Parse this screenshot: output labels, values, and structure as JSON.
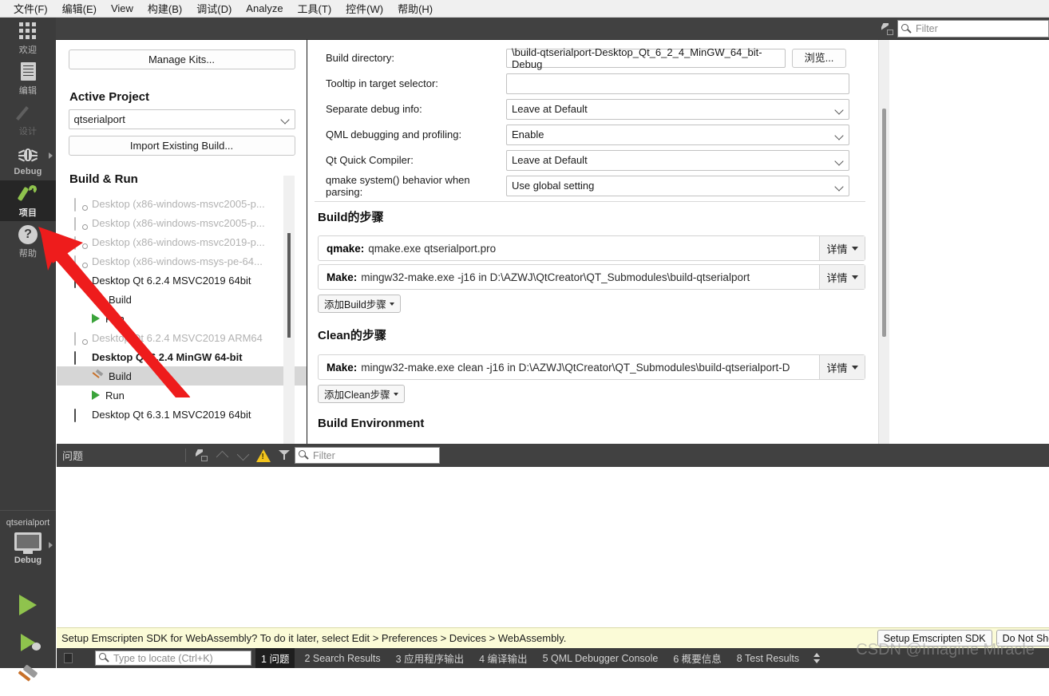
{
  "menubar": {
    "items": [
      "文件(F)",
      "编辑(E)",
      "View",
      "构建(B)",
      "调试(D)",
      "Analyze",
      "工具(T)",
      "控件(W)",
      "帮助(H)"
    ]
  },
  "modebar": {
    "items": [
      {
        "label": "欢迎",
        "icon": "grid-icon"
      },
      {
        "label": "编辑",
        "icon": "document-icon"
      },
      {
        "label": "设计",
        "icon": "pencil-icon"
      },
      {
        "label": "Debug",
        "icon": "bug-icon"
      },
      {
        "label": "项目",
        "icon": "wrench-icon"
      },
      {
        "label": "帮助",
        "icon": "question-icon"
      }
    ],
    "kit_selector": {
      "project": "qtserialport",
      "config": "Debug"
    },
    "active_index": 4,
    "accent_color": "#8fc34d"
  },
  "top_toolbar": {
    "filter_placeholder": "Filter"
  },
  "left_panel": {
    "manage_kits_label": "Manage Kits...",
    "active_project_title": "Active Project",
    "active_project_value": "qtserialport",
    "import_existing_label": "Import Existing Build...",
    "build_run_title": "Build & Run",
    "tree": [
      {
        "label": "Desktop (x86-windows-msvc2005-p...",
        "type": "kit",
        "dim": true
      },
      {
        "label": "Desktop (x86-windows-msvc2005-p...",
        "type": "kit",
        "dim": true
      },
      {
        "label": "Desktop (x86-windows-msvc2019-p...",
        "type": "kit",
        "dim": true
      },
      {
        "label": "Desktop (x86-windows-msys-pe-64...",
        "type": "kit",
        "dim": true
      },
      {
        "label": "Desktop Qt 6.2.4 MSVC2019 64bit",
        "type": "kit",
        "dim": false
      },
      {
        "label": "Build",
        "type": "build",
        "dim": false
      },
      {
        "label": "Run",
        "type": "run",
        "dim": false
      },
      {
        "label": "Desktop Qt 6.2.4 MSVC2019 ARM64",
        "type": "kit",
        "dim": true
      },
      {
        "label": "Desktop Qt 6.2.4 MinGW 64-bit",
        "type": "kit",
        "dim": false,
        "bold": true
      },
      {
        "label": "Build",
        "type": "build",
        "dim": false,
        "selected": true
      },
      {
        "label": "Run",
        "type": "run",
        "dim": false
      },
      {
        "label": "Desktop Qt 6.3.1 MSVC2019 64bit",
        "type": "kit",
        "dim": false
      }
    ]
  },
  "main_panel": {
    "fields": [
      {
        "label": "Build directory:",
        "value": "\\build-qtserialport-Desktop_Qt_6_2_4_MinGW_64_bit-Debug",
        "kind": "path",
        "button": "浏览..."
      },
      {
        "label": "Tooltip in target selector:",
        "value": "",
        "kind": "text"
      },
      {
        "label": "Separate debug info:",
        "value": "Leave at Default",
        "kind": "combo"
      },
      {
        "label": "QML debugging and profiling:",
        "value": "Enable",
        "kind": "combo"
      },
      {
        "label": "Qt Quick Compiler:",
        "value": "Leave at Default",
        "kind": "combo"
      },
      {
        "label": "qmake system() behavior when parsing:",
        "value": "Use global setting",
        "kind": "combo"
      }
    ],
    "build_steps_title": "Build的步骤",
    "build_steps": [
      {
        "name": "qmake:",
        "command": "qmake.exe qtserialport.pro",
        "details": "详情"
      },
      {
        "name": "Make:",
        "command": "mingw32-make.exe  -j16 in D:\\AZWJ\\QtCreator\\QT_Submodules\\build-qtserialport",
        "details": "详情"
      }
    ],
    "add_build_step_label": "添加Build步骤",
    "clean_steps_title": "Clean的步骤",
    "clean_steps": [
      {
        "name": "Make:",
        "command": "mingw32-make.exe clean -j16 in D:\\AZWJ\\QtCreator\\QT_Submodules\\build-qtserialport-D",
        "details": "详情"
      }
    ],
    "add_clean_step_label": "添加Clean步骤",
    "build_environment_title": "Build Environment"
  },
  "issues_pane": {
    "title": "问题",
    "filter_placeholder": "Filter"
  },
  "banner": {
    "message": "Setup Emscripten SDK for WebAssembly? To do it later, select Edit > Preferences > Devices > WebAssembly.",
    "buttons": [
      "Setup Emscripten SDK",
      "Do Not Show Again"
    ],
    "background": "#fbfbd7"
  },
  "statusbar": {
    "locator_placeholder": "Type to locate (Ctrl+K)",
    "tabs": [
      {
        "num": "1",
        "label": "问题",
        "active": true
      },
      {
        "num": "2",
        "label": "Search Results",
        "active": false
      },
      {
        "num": "3",
        "label": "应用程序输出",
        "active": false
      },
      {
        "num": "4",
        "label": "编译输出",
        "active": false
      },
      {
        "num": "5",
        "label": "QML Debugger Console",
        "active": false
      },
      {
        "num": "6",
        "label": "概要信息",
        "active": false
      },
      {
        "num": "8",
        "label": "Test Results",
        "active": false
      }
    ]
  },
  "watermark": "CSDN @Imagine Miracle",
  "annotation": {
    "type": "red-arrow",
    "color": "#ee1c1c"
  }
}
